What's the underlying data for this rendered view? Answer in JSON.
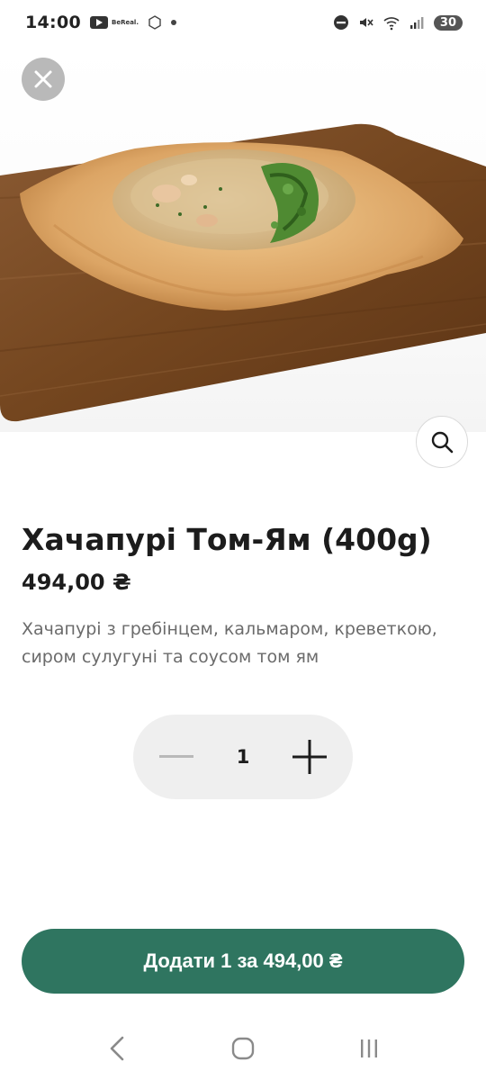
{
  "status_bar": {
    "time": "14:00",
    "notification_app": "BeReal.",
    "battery": "30",
    "icons": [
      "youtube-icon",
      "bereal-icon",
      "hexagon-icon",
      "dot-icon",
      "dnd-icon",
      "mute-icon",
      "wifi-icon",
      "signal-icon"
    ]
  },
  "product": {
    "title": "Хачапурі Том-Ям (400g)",
    "price": "494,00 ₴",
    "description": "Хачапурі з гребінцем, кальмаром, креветкою, сиром сулугуні та соусом том ям",
    "image": "khachapuri-on-wooden-board"
  },
  "quantity": {
    "value": "1",
    "decrement_icon": "minus-icon",
    "increment_icon": "plus-icon"
  },
  "actions": {
    "add_to_cart_label": "Додати 1 за 494,00 ₴",
    "close_icon": "close-icon",
    "zoom_icon": "search-icon"
  },
  "nav": {
    "back_icon": "back-icon",
    "home_icon": "home-icon",
    "recents_icon": "recents-icon"
  },
  "colors": {
    "accent": "#2f7560",
    "stepper_bg": "#efefef",
    "close_bg": "#b9b9b9",
    "description": "#6b6b6b"
  }
}
